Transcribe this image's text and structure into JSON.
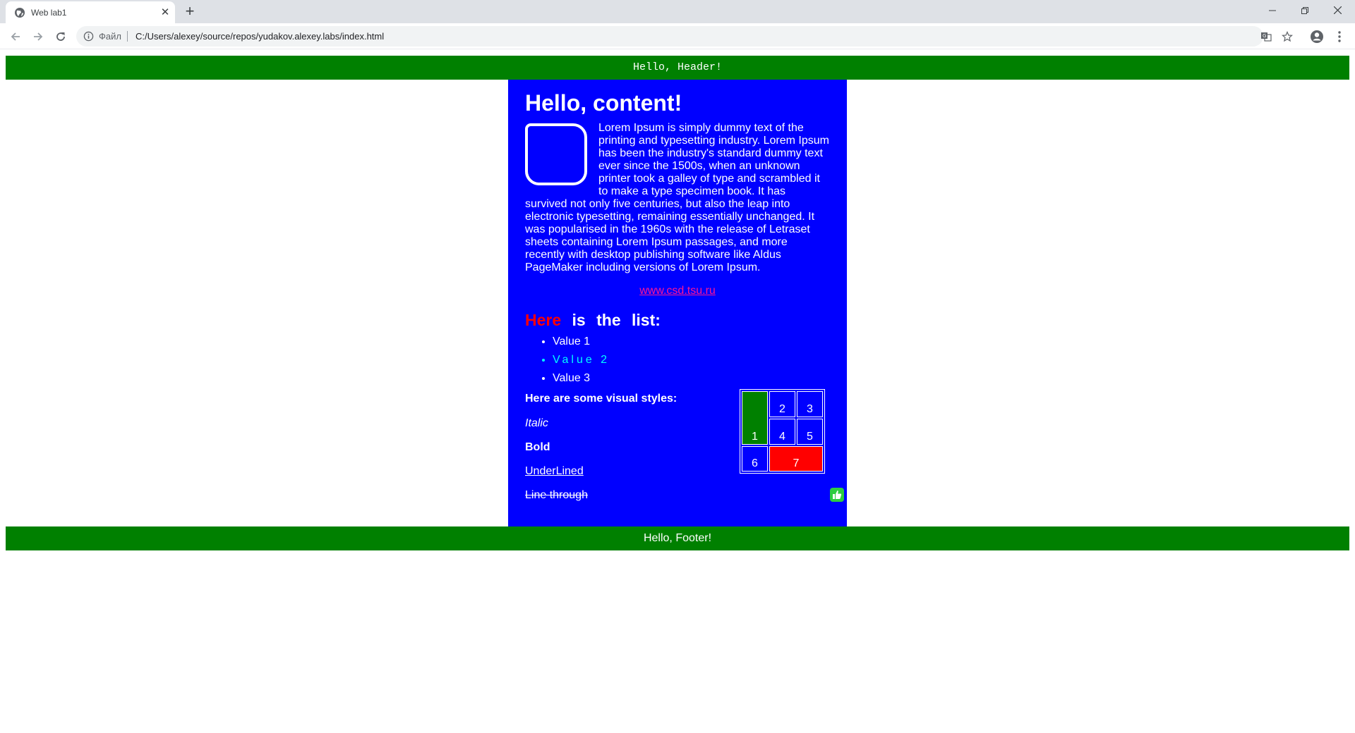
{
  "browser": {
    "tab_title": "Web lab1",
    "tab_close": "✕",
    "new_tab": "+",
    "scheme_label": "Файл",
    "url": "C:/Users/alexey/source/repos/yudakov.alexey.labs/index.html"
  },
  "page": {
    "header": "Hello, Header!",
    "content_title": "Hello, content!",
    "intro": "Lorem Ipsum is simply dummy text of the printing and typesetting industry. Lorem Ipsum has been the industry's standard dummy text ever since the 1500s, when an unknown printer took a galley of type and scrambled it to make a type specimen book. It has survived not only five centuries, but also the leap into electronic typesetting, remaining essentially unchanged. It was popularised in the 1960s with the release of Letraset sheets containing Lorem Ipsum passages, and more recently with desktop publishing software like Aldus PageMaker including versions of Lorem Ipsum.",
    "link": "www.csd.tsu.ru",
    "list_title_highlight": "Here",
    "list_title_rest": "is the list:",
    "list_items": [
      "Value 1",
      "Value 2",
      "Value 3"
    ],
    "styles_title": "Here are some visual styles:",
    "styles": {
      "italic": "Italic",
      "bold": "Bold",
      "underlined": "UnderLined",
      "line_through": "Line through"
    },
    "table": {
      "cells": [
        "1",
        "2",
        "3",
        "4",
        "5",
        "6",
        "7"
      ],
      "green": "#008000",
      "red": "#ff0000"
    },
    "like_icon": "thumbs-up-icon",
    "footer": "Hello, Footer!"
  },
  "colors": {
    "header_bg": "#008000",
    "content_bg": "#0000ff",
    "link": "#ff1493",
    "highlight": "#ff0000",
    "styled_item": "#00ffff"
  }
}
